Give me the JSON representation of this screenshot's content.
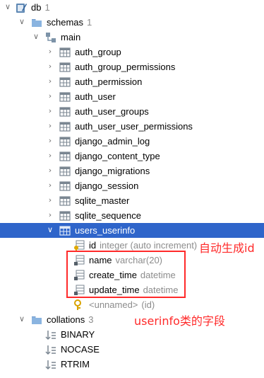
{
  "tree": {
    "db": {
      "label": "db",
      "count": "1"
    },
    "schemas": {
      "label": "schemas",
      "count": "1"
    },
    "main": {
      "label": "main"
    },
    "tables": [
      "auth_group",
      "auth_group_permissions",
      "auth_permission",
      "auth_user",
      "auth_user_groups",
      "auth_user_user_permissions",
      "django_admin_log",
      "django_content_type",
      "django_migrations",
      "django_session",
      "sqlite_master",
      "sqlite_sequence"
    ],
    "selected_table": {
      "label": "users_userinfo"
    },
    "columns": [
      {
        "name": "id",
        "type": "integer (auto increment)"
      },
      {
        "name": "name",
        "type": "varchar(20)"
      },
      {
        "name": "create_time",
        "type": "datetime"
      },
      {
        "name": "update_time",
        "type": "datetime"
      }
    ],
    "key": {
      "label": "<unnamed>",
      "type": "(id)"
    },
    "collations": {
      "label": "collations",
      "count": "3"
    },
    "collation_items": [
      "BINARY",
      "NOCASE",
      "RTRIM"
    ]
  },
  "annotations": {
    "id_note": "自动生成id",
    "fields_note": "userinfo类的字段"
  },
  "colors": {
    "selection": "#2f65ca",
    "annotation": "#ff2a2a",
    "folder": "#8ab4e0",
    "table_icon": "#7a8691"
  }
}
